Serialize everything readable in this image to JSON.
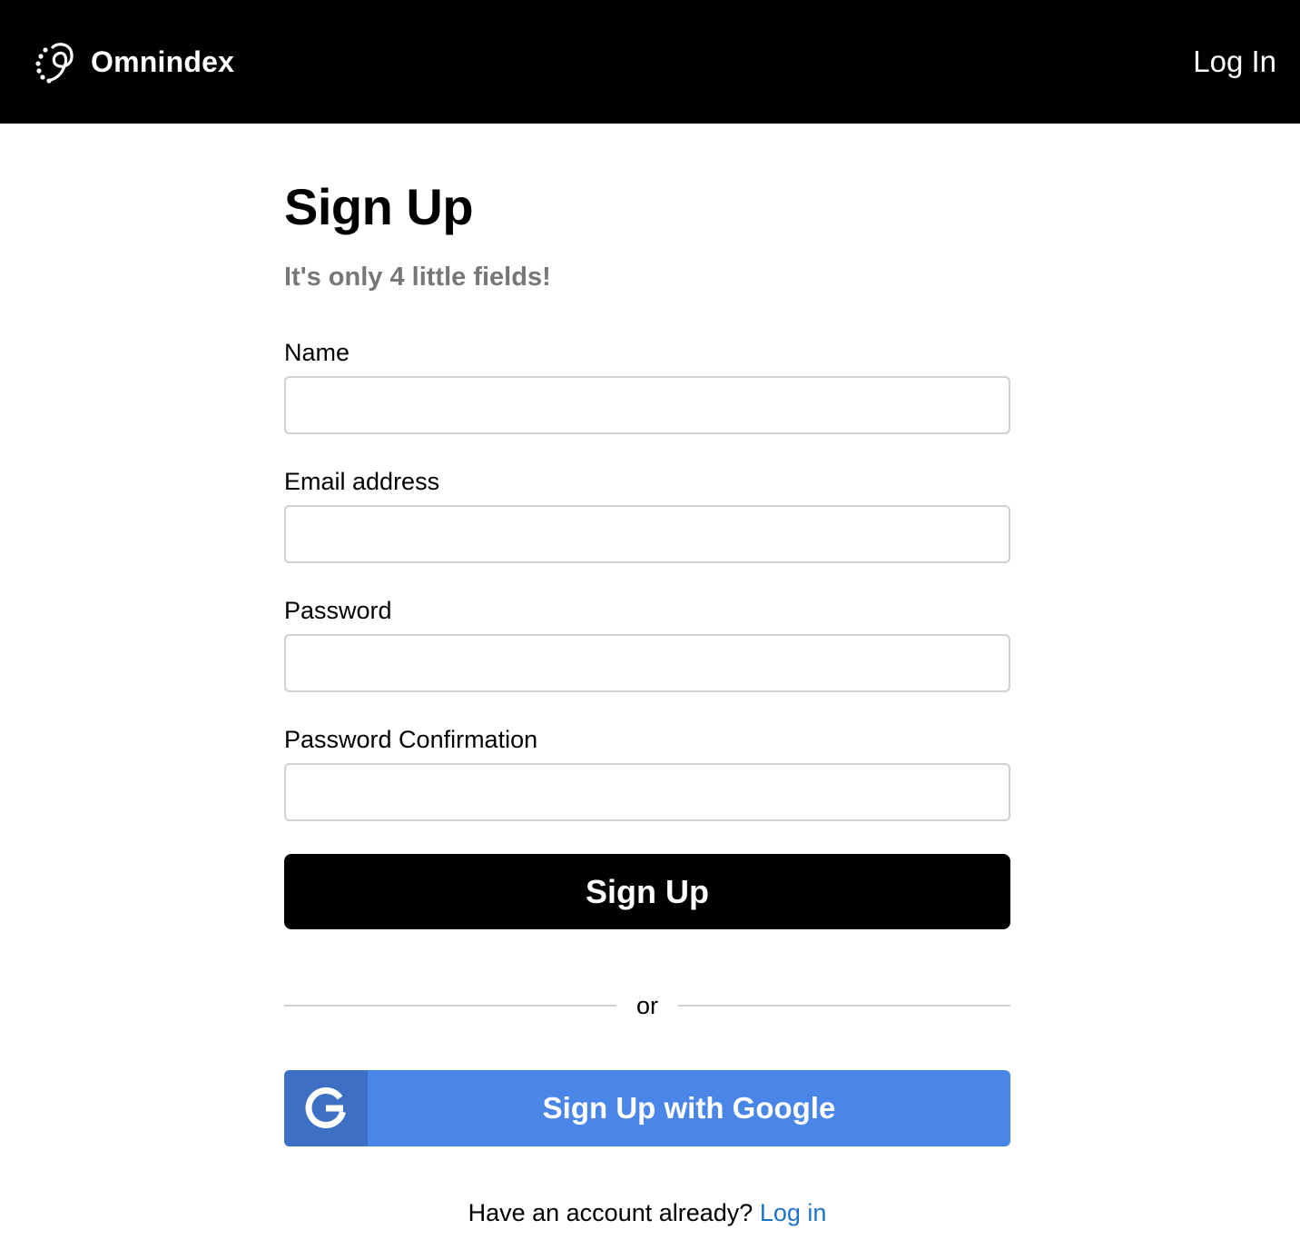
{
  "navbar": {
    "brand_name": "Omnindex",
    "login_label": "Log In"
  },
  "form": {
    "title": "Sign Up",
    "subtitle": "It's only 4 little fields!",
    "fields": [
      {
        "label": "Name",
        "value": "",
        "placeholder": ""
      },
      {
        "label": "Email address",
        "value": "",
        "placeholder": ""
      },
      {
        "label": "Password",
        "value": "",
        "placeholder": ""
      },
      {
        "label": "Password Confirmation",
        "value": "",
        "placeholder": ""
      }
    ],
    "submit_label": "Sign Up",
    "divider_text": "or",
    "google_label": "Sign Up with Google"
  },
  "footer": {
    "prompt": "Have an account already?",
    "login_link": "Log in"
  },
  "colors": {
    "navbar_bg": "#000000",
    "google_blue": "#4a86e8",
    "google_icon_bg": "#3d6fc4",
    "link_blue": "#1a73c9",
    "subtitle_gray": "#777777"
  },
  "icons": {
    "brand": "omnindex-logo-icon",
    "google": "google-g-icon"
  }
}
